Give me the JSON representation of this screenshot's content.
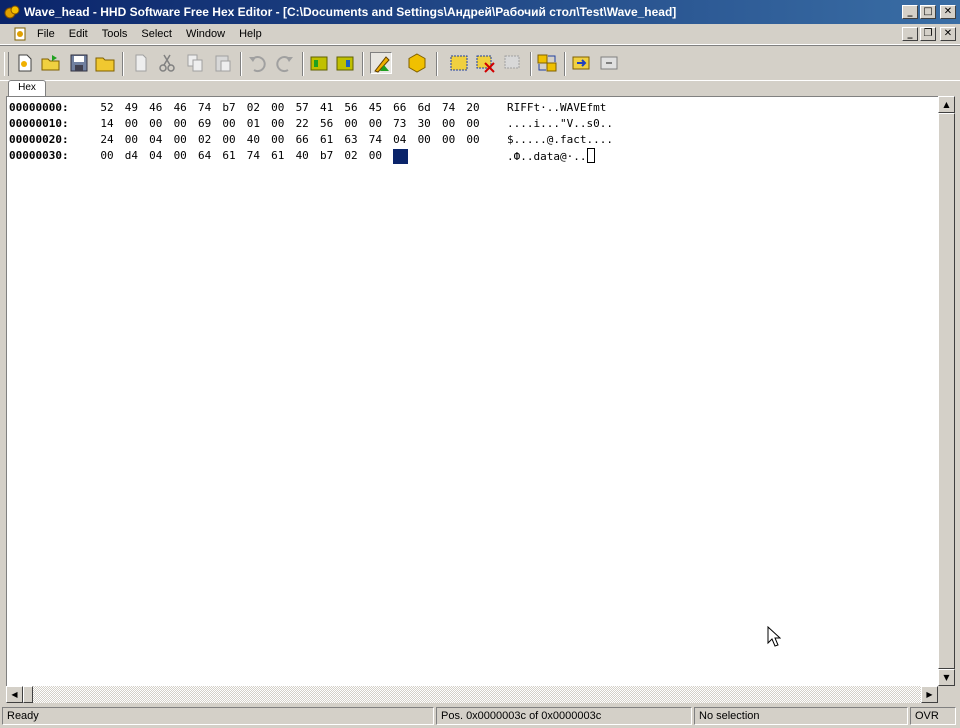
{
  "window": {
    "title": "Wave_head - HHD Software Free Hex Editor - [C:\\Documents and Settings\\Андрей\\Рабочий стол\\Test\\Wave_head]",
    "minimize": "_",
    "maximize": "□",
    "close": "✕",
    "mdi_restore": "❐"
  },
  "menu": {
    "items": [
      "File",
      "Edit",
      "Tools",
      "Select",
      "Window",
      "Help"
    ]
  },
  "toolbar": {
    "buttons": [
      "new-file",
      "open-file",
      "save",
      "open-folder",
      "find",
      "cut",
      "copy",
      "paste",
      "undo",
      "redo",
      "bookmark-prev",
      "bookmark-next",
      "edit-mode",
      "hexagon",
      "select-block",
      "clear-selection",
      "disabled-tool",
      "compare",
      "export",
      "link"
    ]
  },
  "tabs": [
    {
      "label": "Hex"
    }
  ],
  "hex": {
    "rows": [
      {
        "offset": "00000000:",
        "bytes": [
          "52",
          "49",
          "46",
          "46",
          "74",
          "b7",
          "02",
          "00",
          "57",
          "41",
          "56",
          "45",
          "66",
          "6d",
          "74",
          "20"
        ],
        "ascii": "RIFFt·..WAVEfmt "
      },
      {
        "offset": "00000010:",
        "bytes": [
          "14",
          "00",
          "00",
          "00",
          "69",
          "00",
          "01",
          "00",
          "22",
          "56",
          "00",
          "00",
          "73",
          "30",
          "00",
          "00"
        ],
        "ascii": "....i...\"V..s0.."
      },
      {
        "offset": "00000020:",
        "bytes": [
          "24",
          "00",
          "04",
          "00",
          "02",
          "00",
          "40",
          "00",
          "66",
          "61",
          "63",
          "74",
          "04",
          "00",
          "00",
          "00"
        ],
        "ascii": "$.....@.fact...."
      },
      {
        "offset": "00000030:",
        "bytes": [
          "00",
          "d4",
          "04",
          "00",
          "64",
          "61",
          "74",
          "61",
          "40",
          "b7",
          "02",
          "00"
        ],
        "ascii": ".Ф..data@·.."
      }
    ]
  },
  "status": {
    "ready": "Ready",
    "position": "Pos. 0x0000003c of 0x0000003c",
    "selection": "No selection",
    "mode": "OVR"
  },
  "scroll": {
    "up": "▲",
    "down": "▼",
    "left": "◀",
    "right": "▶"
  }
}
